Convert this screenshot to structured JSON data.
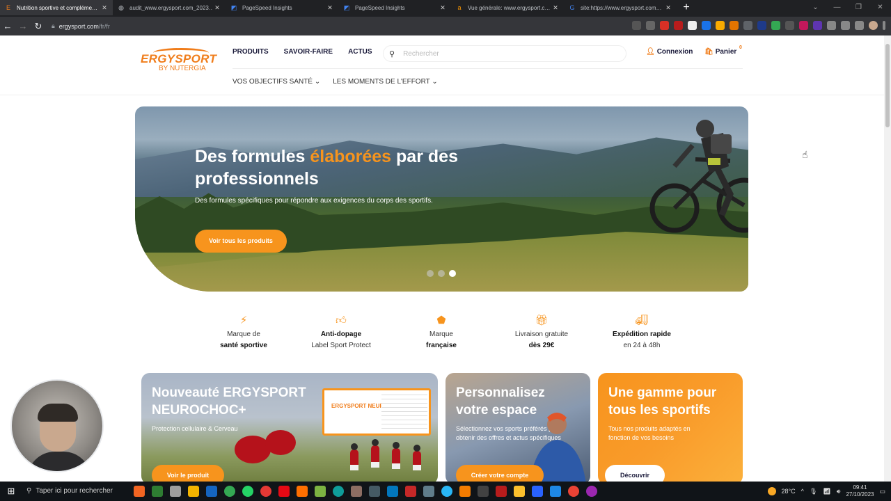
{
  "browser": {
    "tabs": [
      {
        "title": "Nutrition sportive et compléme…",
        "favicon": "ergysport-icon",
        "active": true
      },
      {
        "title": "audit_www.ergysport.com_2023…",
        "favicon": "globe-icon",
        "active": false
      },
      {
        "title": "PageSpeed Insights",
        "favicon": "pagespeed-icon",
        "active": false
      },
      {
        "title": "PageSpeed Insights",
        "favicon": "pagespeed-icon",
        "active": false
      },
      {
        "title": "Vue générale: www.ergysport.c…",
        "favicon": "amazon-icon",
        "active": false
      },
      {
        "title": "site:https://www.ergysport.com…",
        "favicon": "google-icon",
        "active": false
      }
    ],
    "url_host": "ergysport.com",
    "url_path": "/fr/fr"
  },
  "site": {
    "logo_brand": "ERGYSPORT",
    "logo_sub": "BY NUTERGIA",
    "nav_primary": [
      "PRODUITS",
      "SAVOIR-FAIRE",
      "ACTUS"
    ],
    "search_placeholder": "Rechercher",
    "login_label": "Connexion",
    "cart_label": "Panier",
    "cart_count": "0",
    "nav_secondary": [
      "VOS OBJECTIFS SANTÉ",
      "LES MOMENTS DE L'EFFORT"
    ]
  },
  "hero": {
    "title_part1": "Des formules ",
    "title_highlight": "élaborées",
    "title_part2": " par des professionnels",
    "description": "Des formules spécifiques pour répondre aux exigences du corps des sportifs.",
    "cta": "Voir tous les produits",
    "slide_count": 3,
    "active_slide": 3
  },
  "features": [
    {
      "icon": "runner-icon",
      "line1": "Marque de",
      "line2": "santé sportive",
      "bold_line": 2
    },
    {
      "icon": "thumbs-up-icon",
      "line1": "Anti-dopage",
      "line2": "Label Sport Protect",
      "bold_line": 1
    },
    {
      "icon": "rooster-icon",
      "line1": "Marque",
      "line2": "française",
      "bold_line": 2
    },
    {
      "icon": "gift-icon",
      "line1": "Livraison gratuite",
      "line2": "dès 29€",
      "bold_line": 2
    },
    {
      "icon": "truck-icon",
      "line1": "Expédition rapide",
      "line2": "en 24 à 48h",
      "bold_line": 1
    }
  ],
  "cards": [
    {
      "title": "Nouveauté ERGYSPORT NEUROCHOC+",
      "text": "Protection cellulaire & Cerveau",
      "button": "Voir le produit",
      "box_label": "ERGYSPORT NEUROCHOC+"
    },
    {
      "title": "Personnalisez votre espace",
      "text": "Sélectionnez vos sports préférés pour obtenir des offres et actus spécifiques",
      "button": "Créer votre compte"
    },
    {
      "title": "Une gamme pour tous les sportifs",
      "text": "Tous nos produits adaptés en fonction de vos besoins",
      "button": "Découvrir"
    }
  ],
  "taskbar": {
    "search_placeholder": "Taper ici pour rechercher",
    "temperature": "28°C",
    "time": "09:41",
    "date": "27/10/2023"
  },
  "colors": {
    "accent": "#f7941d",
    "navy": "#1a1a3a",
    "chrome_dark": "#202124"
  }
}
